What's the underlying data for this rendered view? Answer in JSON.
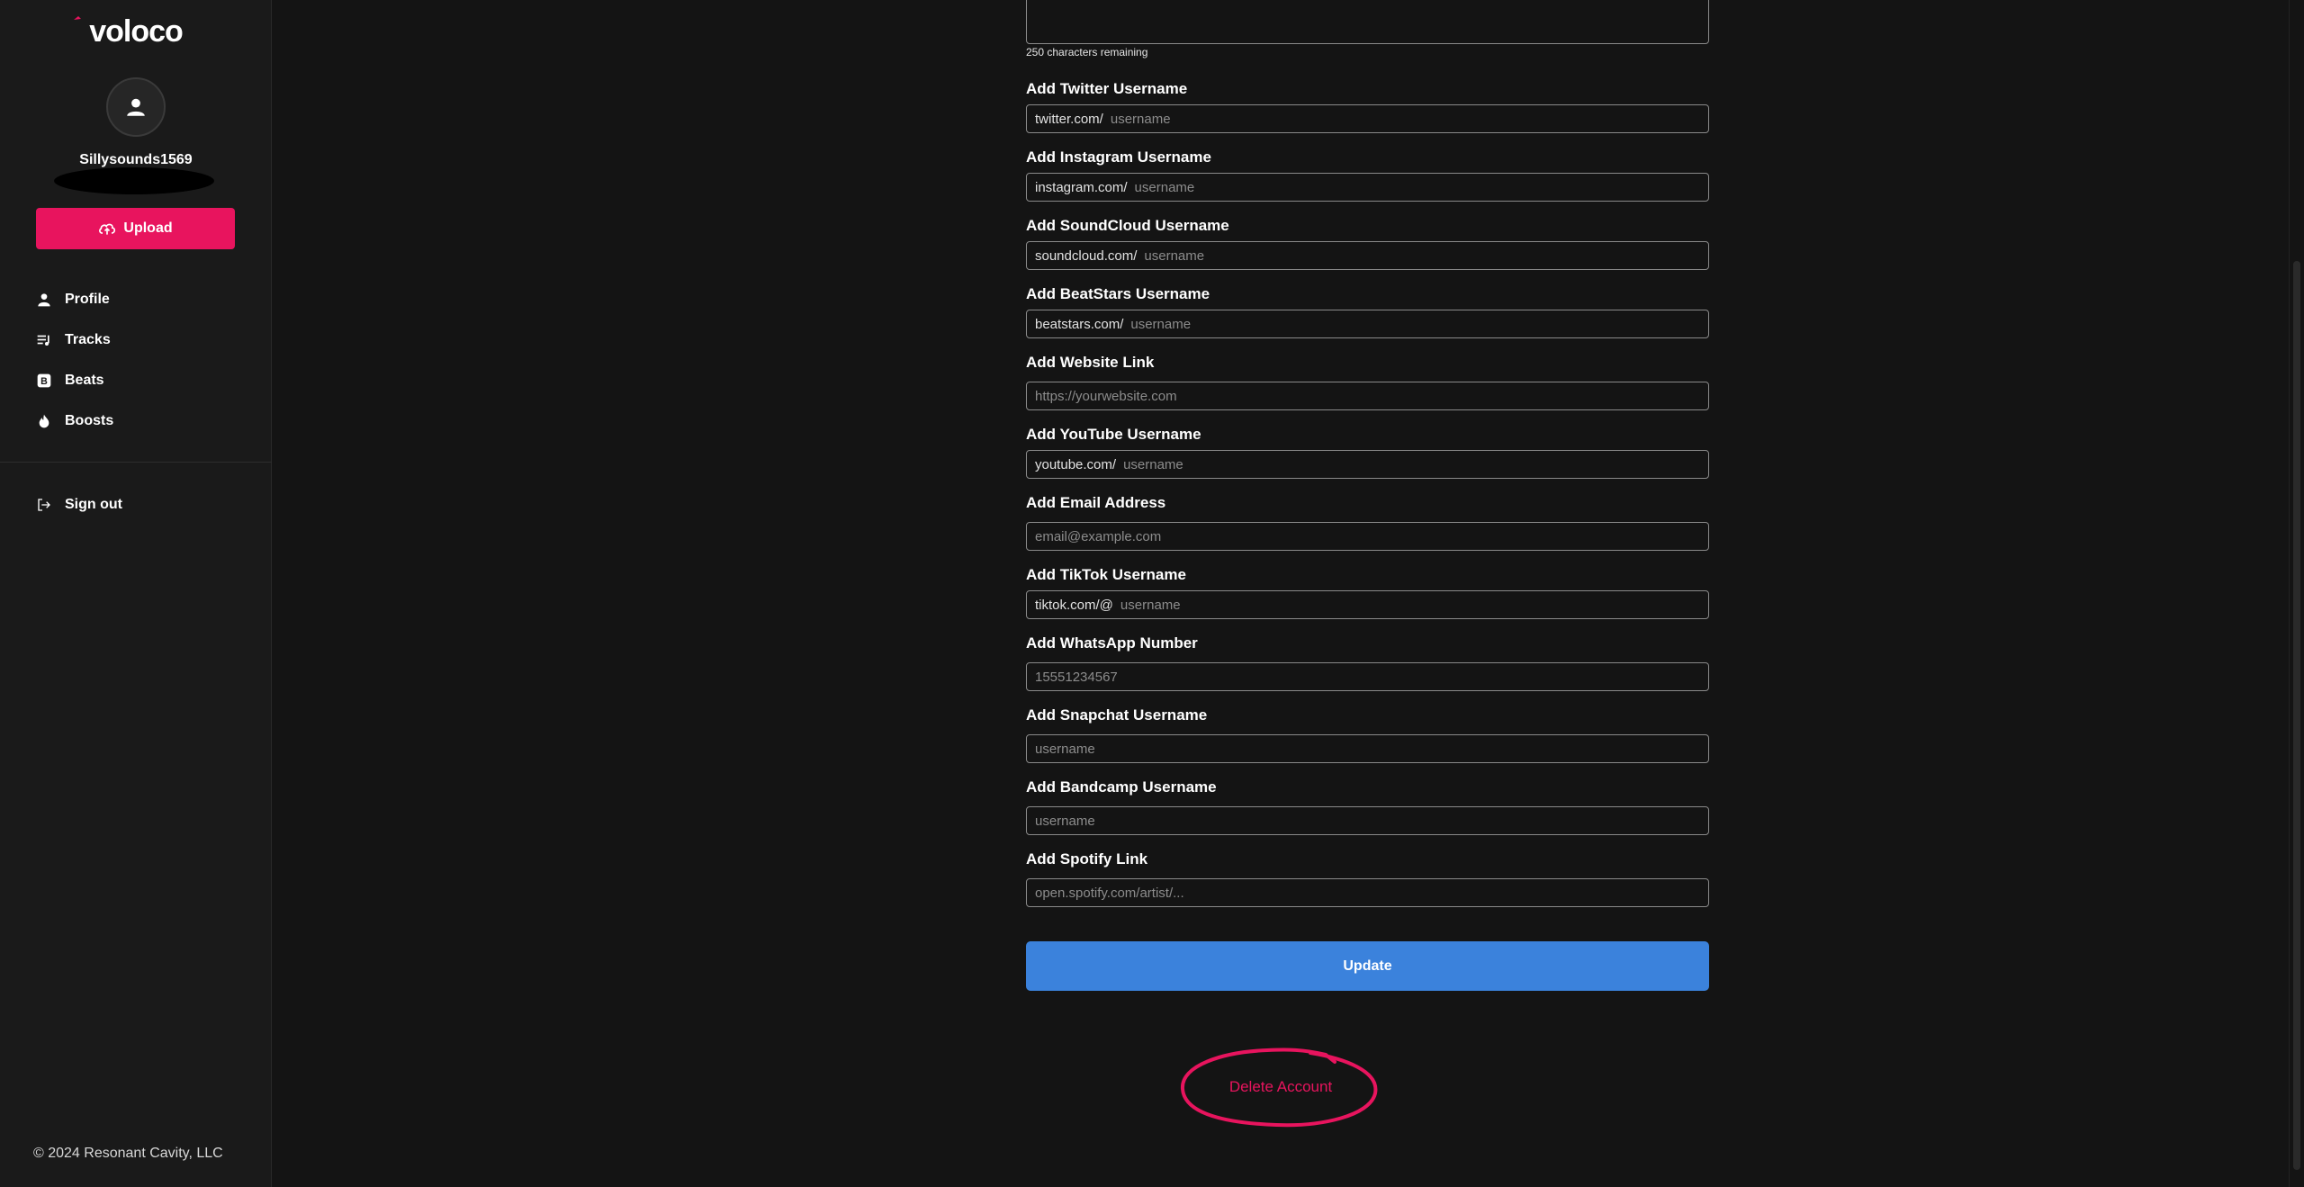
{
  "app": {
    "logo_text": "voloco",
    "username": "Sillysounds1569",
    "upload_label": "Upload",
    "copyright": "© 2024 Resonant Cavity, LLC",
    "brand_color": "#e8145e",
    "accent_blue": "#3b82dc"
  },
  "sidebar": {
    "items": [
      {
        "label": "Profile",
        "icon": "person-icon"
      },
      {
        "label": "Tracks",
        "icon": "playlist-icon"
      },
      {
        "label": "Beats",
        "icon": "beats-b-icon"
      },
      {
        "label": "Boosts",
        "icon": "flame-icon"
      }
    ],
    "signout_label": "Sign out"
  },
  "form": {
    "chars_remaining": "250 characters remaining",
    "fields": [
      {
        "label": "Add Twitter Username",
        "prefix": "twitter.com/",
        "placeholder": "username"
      },
      {
        "label": "Add Instagram Username",
        "prefix": "instagram.com/",
        "placeholder": "username"
      },
      {
        "label": "Add SoundCloud Username",
        "prefix": "soundcloud.com/",
        "placeholder": "username"
      },
      {
        "label": "Add BeatStars Username",
        "prefix": "beatstars.com/",
        "placeholder": "username"
      },
      {
        "label": "Add Website Link",
        "prefix": "",
        "placeholder": "https://yourwebsite.com"
      },
      {
        "label": "Add YouTube Username",
        "prefix": "youtube.com/",
        "placeholder": "username"
      },
      {
        "label": "Add Email Address",
        "prefix": "",
        "placeholder": "email@example.com"
      },
      {
        "label": "Add TikTok Username",
        "prefix": "tiktok.com/@",
        "placeholder": "username"
      },
      {
        "label": "Add WhatsApp Number",
        "prefix": "",
        "placeholder": "15551234567"
      },
      {
        "label": "Add Snapchat Username",
        "prefix": "",
        "placeholder": "username"
      },
      {
        "label": "Add Bandcamp Username",
        "prefix": "",
        "placeholder": "username"
      },
      {
        "label": "Add Spotify Link",
        "prefix": "",
        "placeholder": "open.spotify.com/artist/..."
      }
    ],
    "update_label": "Update",
    "delete_label": "Delete Account"
  }
}
